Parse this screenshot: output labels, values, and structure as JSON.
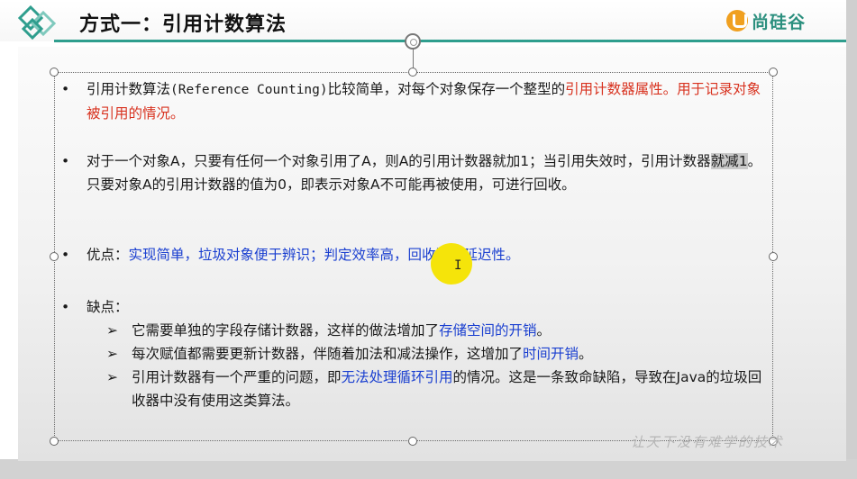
{
  "header": {
    "title": "方式一：引用计数算法",
    "brand": "尚硅谷"
  },
  "colors": {
    "accent_teal": "#2f9e8e",
    "brand_orange": "#f0a020",
    "highlight_red": "#d8321f",
    "highlight_blue": "#1a3fd0",
    "cursor_yellow": "#f5e40a"
  },
  "icons": {
    "logo": "teal-diamond-logo-icon",
    "rotate": "rotate-handle-icon",
    "cursor": "text-cursor-icon"
  },
  "bullets": {
    "marker": "•",
    "sub_marker": "➢",
    "b1": {
      "t1": "引用计数算法",
      "t2": "(Reference Counting)",
      "t3": "比较简单，对每个对象保存一个整型的",
      "t4": "引用计数器属性。用于记录对象被引用的情况。"
    },
    "b2": {
      "t1": "对于一个对象A，只要有任何一个对象引用了A，则A的引用计数器就加1；当引用失效时，引用计数器",
      "t2": "就减1",
      "t3": "。只要对象A的引用计数器的值为0，即表示对象A不可能再被使用，可进行回收。"
    },
    "b3": {
      "label": "优点：",
      "text": "实现简单，垃圾对象便于辨识；判定效率高，回收没有延迟性。"
    },
    "b4": {
      "label": "缺点：",
      "s1a": "它需要单独的字段存储计数器，这样的做法增加了",
      "s1b": "存储空间的开销",
      "s1c": "。",
      "s2a": "每次赋值都需要更新计数器，伴随着加法和减法操作，这增加了",
      "s2b": "时间开销",
      "s2c": "。",
      "s3a": "引用计数器有一个严重的问题，即",
      "s3b": "无法处理循环引用",
      "s3c": "的情况。这是一条致命缺陷，导致在Java的垃圾回收器中没有使用这类算法。"
    }
  },
  "watermark": "让天下没有难学的技术"
}
